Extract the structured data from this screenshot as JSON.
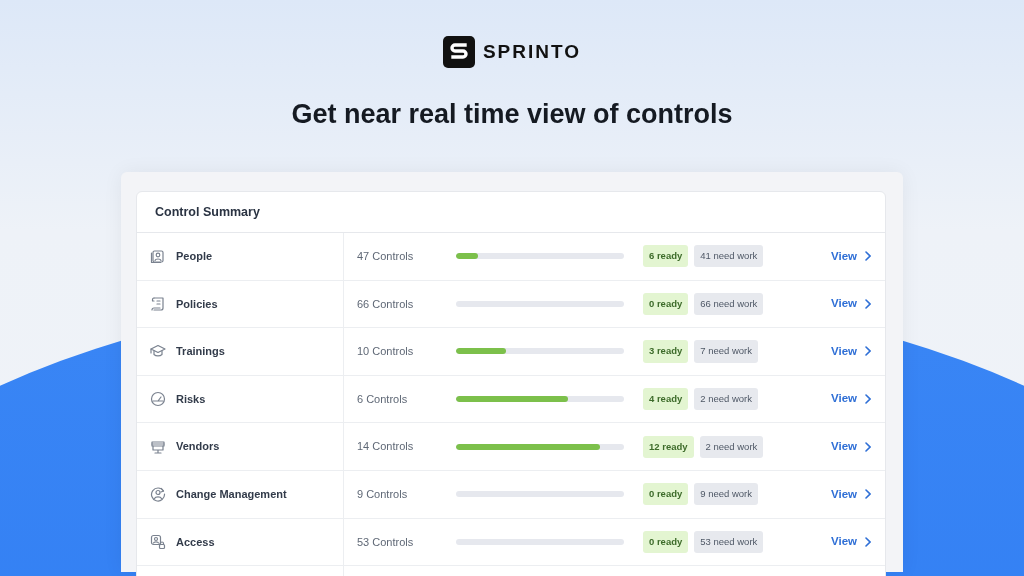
{
  "brand": {
    "name": "SPRINTO"
  },
  "headline": "Get near real time view of controls",
  "summary": {
    "title": "Control Summary",
    "rows": [
      {
        "name": "People",
        "count": "47 Controls",
        "level": 0.128,
        "ready": "6 ready",
        "need_work": "41 need work",
        "link": "View"
      },
      {
        "name": "Policies",
        "count": "66 Controls",
        "level": 0,
        "ready": "0 ready",
        "need_work": "66 need work",
        "link": "View"
      },
      {
        "name": "Trainings",
        "count": "10 Controls",
        "level": 0.3,
        "ready": "3 ready",
        "need_work": "7 need work",
        "link": "View"
      },
      {
        "name": "Risks",
        "count": "6 Controls",
        "level": 0.667,
        "ready": "4 ready",
        "need_work": "2 need work",
        "link": "View"
      },
      {
        "name": "Vendors",
        "count": "14 Controls",
        "level": 0.857,
        "ready": "12 ready",
        "need_work": "2 need work",
        "link": "View"
      },
      {
        "name": "Change Management",
        "count": "9 Controls",
        "level": 0,
        "ready": "0 ready",
        "need_work": "9 need work",
        "link": "View"
      },
      {
        "name": "Access",
        "count": "53 Controls",
        "level": 0,
        "ready": "0 ready",
        "need_work": "53 need work",
        "link": "View"
      }
    ]
  }
}
